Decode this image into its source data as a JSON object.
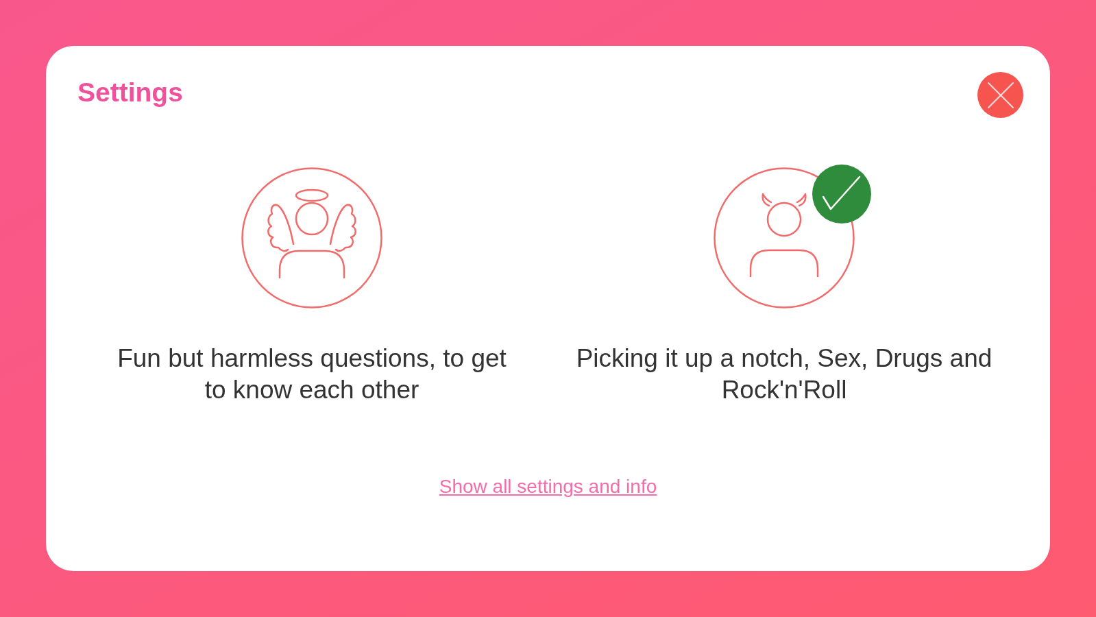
{
  "title": "Settings",
  "options": [
    {
      "kind": "angel",
      "description": "Fun but harmless questions, to get to know each other",
      "selected": false
    },
    {
      "kind": "devil",
      "description": "Picking it up a notch, Sex, Drugs and Rock'n'Roll",
      "selected": true
    }
  ],
  "link": "Show all settings and info"
}
